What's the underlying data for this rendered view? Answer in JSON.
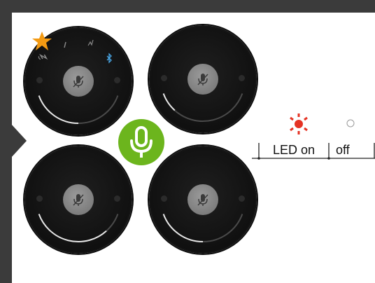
{
  "legend": {
    "on_label": "LED on",
    "off_label": "off",
    "on_color": "#e53324",
    "off_color": "#9a9a9a"
  },
  "colors": {
    "frame": "#3b3b3b",
    "puck": "#111111",
    "mic_button": "#7d7d7d",
    "badge": "#6cb51d",
    "star": "#f39a13",
    "arc": "#e6e6e6",
    "bluetooth": "#4aa8e8"
  },
  "icons": {
    "left_chevron": "chevron-right-icon",
    "microphone": "microphone-icon",
    "muted_mic": "muted-microphone-icon",
    "star": "star-icon",
    "nfc": "nfc-icon",
    "bluetooth": "bluetooth-icon"
  },
  "pucks": [
    {
      "id": "top-left",
      "arc_fill": 0.5,
      "has_icons": true
    },
    {
      "id": "top-right",
      "arc_fill": 0.2,
      "has_icons": false
    },
    {
      "id": "bottom-left",
      "arc_fill": 0.8,
      "has_icons": false
    },
    {
      "id": "bottom-right",
      "arc_fill": 0.5,
      "has_icons": false
    }
  ]
}
